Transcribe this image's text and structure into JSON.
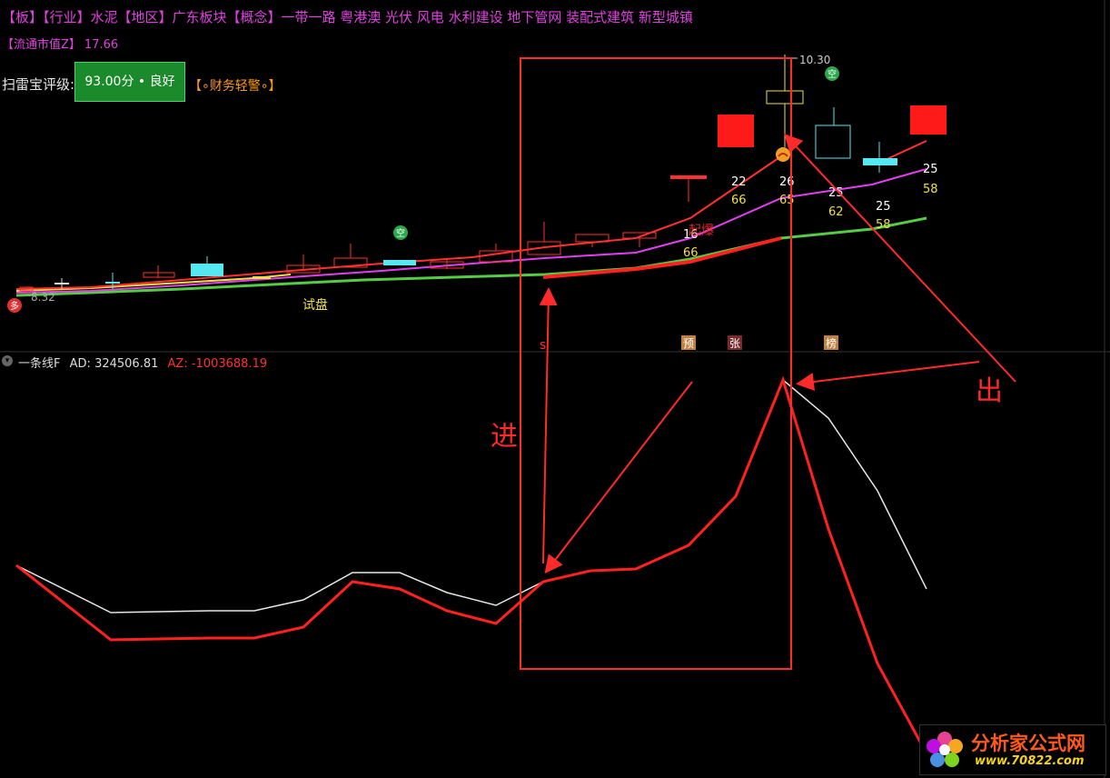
{
  "header": {
    "line1": "【板】【行业】水泥【地区】广东板块【概念】一带一路 粤港澳 光伏 风电 水利建设 地下管网 装配式建筑 新型城镇",
    "line2_label": "【流通市值Z】",
    "line2_value": "17.66",
    "scan_label": "扫雷宝评级:",
    "scan_score": "93.00分 • 良好",
    "finance_warning": "【∘财务轻警∘】"
  },
  "colors": {
    "background": "#000000",
    "up": "#ff3030",
    "cyan": "#55e8f0",
    "magenta": "#e040f0",
    "green_ma": "#55cc44",
    "yellow_ma": "#f0e040",
    "annotation": "#ff2a2a"
  },
  "chart_data": [
    {
      "type": "candlestick",
      "panel": "price",
      "price_labels": {
        "low": "8.32",
        "high": "10.30"
      },
      "ma_labels": [
        {
          "upper": "16",
          "lower": "66"
        },
        {
          "upper": "22",
          "lower": "66"
        },
        {
          "upper": "26",
          "lower": "65"
        },
        {
          "upper": "25",
          "lower": "62"
        },
        {
          "upper": "25",
          "lower": "58"
        },
        {
          "upper": "25",
          "lower": "58"
        }
      ],
      "badges": [
        {
          "text": "空",
          "color": "#2aa84a"
        },
        {
          "text": "空",
          "color": "#2aa84a"
        },
        {
          "text": "多",
          "color": "#e03030"
        }
      ],
      "texts": {
        "trial": "试盘",
        "start": "起爆"
      },
      "markers": [
        {
          "text": "预"
        },
        {
          "text": "张"
        },
        {
          "text": "榜"
        },
        {
          "text": "s"
        }
      ]
    },
    {
      "type": "line",
      "panel": "indicator",
      "title": "一条线F",
      "ad_label": "AD:",
      "ad_value": "324506.81",
      "az_label": "AZ:",
      "az_value": "-1003688.19",
      "series": [
        {
          "name": "AD",
          "color": "#e8e8e8"
        },
        {
          "name": "AZ",
          "color": "#ff2020"
        }
      ]
    }
  ],
  "annotations": {
    "enter": "进",
    "exit": "出"
  },
  "watermark": {
    "title": "分析家公式网",
    "url": "www.70822.com"
  }
}
